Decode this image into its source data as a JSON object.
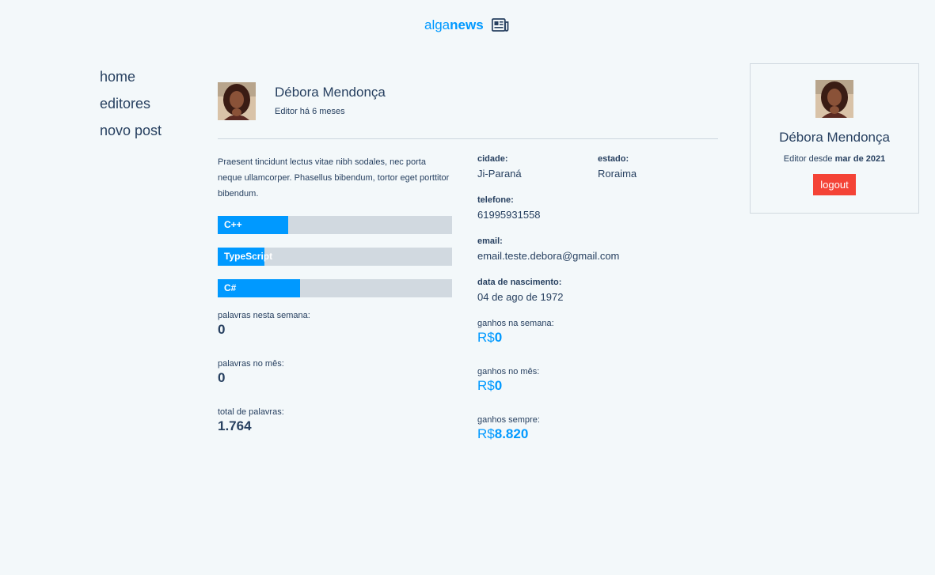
{
  "header": {
    "brand_light": "alga",
    "brand_bold": "news",
    "icon": "newspaper-icon",
    "accent": "#0099ff"
  },
  "nav": {
    "items": [
      {
        "label": "home"
      },
      {
        "label": "editores"
      },
      {
        "label": "novo post"
      }
    ]
  },
  "profile": {
    "name": "Débora Mendonça",
    "since": "Editor há 6 meses",
    "bio": "Praesent tincidunt lectus vitae nibh sodales, nec porta neque ullamcorper. Phasellus bibendum, tortor eget porttitor bibendum.",
    "skills": [
      {
        "name": "C++",
        "level": 0.3
      },
      {
        "name": "TypeScript",
        "level": 0.2
      },
      {
        "name": "C#",
        "level": 0.35
      }
    ],
    "stats": [
      {
        "label": "palavras nesta semana:",
        "value": "0"
      },
      {
        "label": "palavras no mês:",
        "value": "0"
      },
      {
        "label": "total de palavras:",
        "value": "1.764"
      }
    ],
    "earnings": [
      {
        "label": "ganhos na semana:",
        "currency": "R$",
        "value": "0"
      },
      {
        "label": "ganhos no mês:",
        "currency": "R$",
        "value": "0"
      },
      {
        "label": "ganhos sempre:",
        "currency": "R$",
        "value": "8.820"
      }
    ],
    "contact": {
      "city_label": "cidade:",
      "city": "Ji-Paraná",
      "state_label": "estado:",
      "state": "Roraima",
      "phone_label": "telefone:",
      "phone": "61995931558",
      "email_label": "email:",
      "email": "email.teste.debora@gmail.com",
      "birth_label": "data de nascimento:",
      "birth": "04 de ago de 1972"
    }
  },
  "user_card": {
    "name": "Débora Mendonça",
    "since_prefix": "Editor desde",
    "since_date": "mar de 2021",
    "logout_label": "logout",
    "logout_color": "#f44336"
  }
}
